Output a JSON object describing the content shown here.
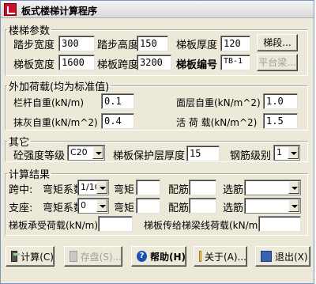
{
  "title": "板式楼梯计算程序",
  "stair_params": {
    "legend": "楼梯参数",
    "step_width_label": "踏步宽度",
    "step_width_value": "300",
    "step_height_label": "踏步高度",
    "step_height_value": "150",
    "slab_thickness_label": "梯板厚度",
    "slab_thickness_value": "120",
    "segment_button": "梯段...",
    "slab_width_label": "梯板宽度",
    "slab_width_value": "1600",
    "span_label": "梯板跨度",
    "span_value": "3200",
    "slab_code_label": "梯板编号",
    "slab_code_value": "TB-1",
    "platform_beam_button": "平台梁..."
  },
  "extra_load": {
    "legend": "外加荷载(均为标准值)",
    "railing_label": "栏杆自重(kN/m)",
    "railing_value": "0.1",
    "surface_label": "面层自重(kN/m^2)",
    "surface_value": "1.0",
    "plaster_label": "抹灰自重(kN/m^2)",
    "plaster_value": "0.4",
    "live_label": "活 荷 载(kN/m^2)",
    "live_value": "1.5"
  },
  "other": {
    "legend": "其它",
    "concrete_label": "砼强度等级",
    "concrete_value": "C20",
    "cover_label": "梯板保护层厚度",
    "cover_value": "15",
    "rebar_label": "钢筋级别",
    "rebar_value": "1"
  },
  "results": {
    "legend": "计算结果",
    "mid_label": "跨中:",
    "mid_coef_label": "弯矩系数",
    "mid_coef_value": "1/10",
    "moment_label": "弯矩",
    "reinf_label": "配筋",
    "select_label": "选筋",
    "support_label": "支座:",
    "support_coef_label": "弯矩系数",
    "support_coef_value": "0",
    "slab_load_label": "梯板承受荷载(kN/m)",
    "beam_load_label": "梯板传给梯梁线荷载(kN/m"
  },
  "buttons": {
    "calc": "计算(C)",
    "save": "存盘(S)...",
    "help": "帮助(H)",
    "about": "关于(A)...",
    "exit": "退出(X)"
  }
}
